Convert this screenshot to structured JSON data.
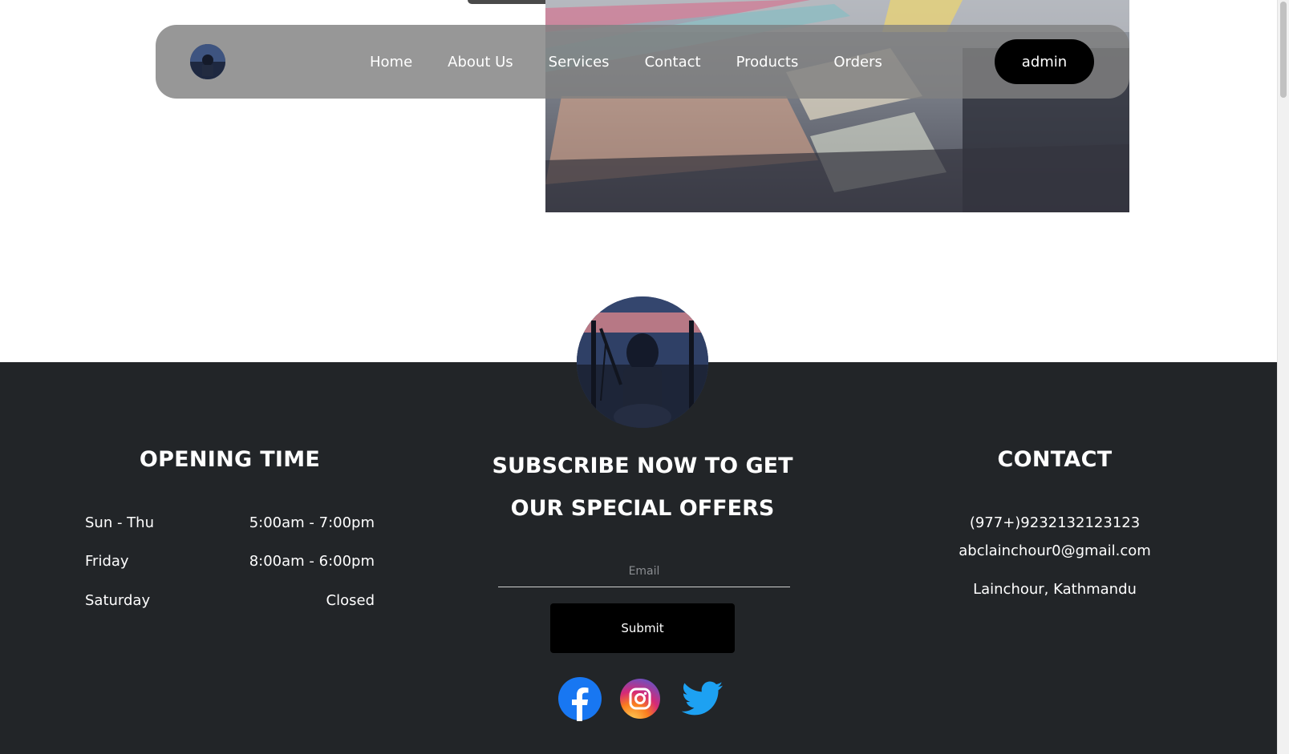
{
  "nav": {
    "links": [
      "Home",
      "About Us",
      "Services",
      "Contact",
      "Products",
      "Orders"
    ],
    "admin_label": "admin"
  },
  "footer": {
    "opening": {
      "title": "OPENING TIME",
      "rows": [
        {
          "day": "Sun - Thu",
          "hours": "5:00am - 7:00pm"
        },
        {
          "day": "Friday",
          "hours": "8:00am - 6:00pm"
        },
        {
          "day": "Saturday",
          "hours": "Closed"
        }
      ]
    },
    "subscribe": {
      "title_line1": "SUBSCRIBE NOW TO GET",
      "title_line2": "OUR SPECIAL OFFERS",
      "email_placeholder": "Email",
      "submit_label": "Submit"
    },
    "contact": {
      "title": "CONTACT",
      "phone": "(977+)9232132123123",
      "email": "abclainchour0@gmail.com",
      "address": "Lainchour, Kathmandu"
    },
    "social_icons": [
      "facebook-icon",
      "instagram-icon",
      "twitter-icon"
    ]
  },
  "colors": {
    "footer_bg": "#222528",
    "nav_bg": "#808080",
    "button_bg": "#000000",
    "facebook": "#1877F2",
    "twitter": "#1DA1F2"
  }
}
